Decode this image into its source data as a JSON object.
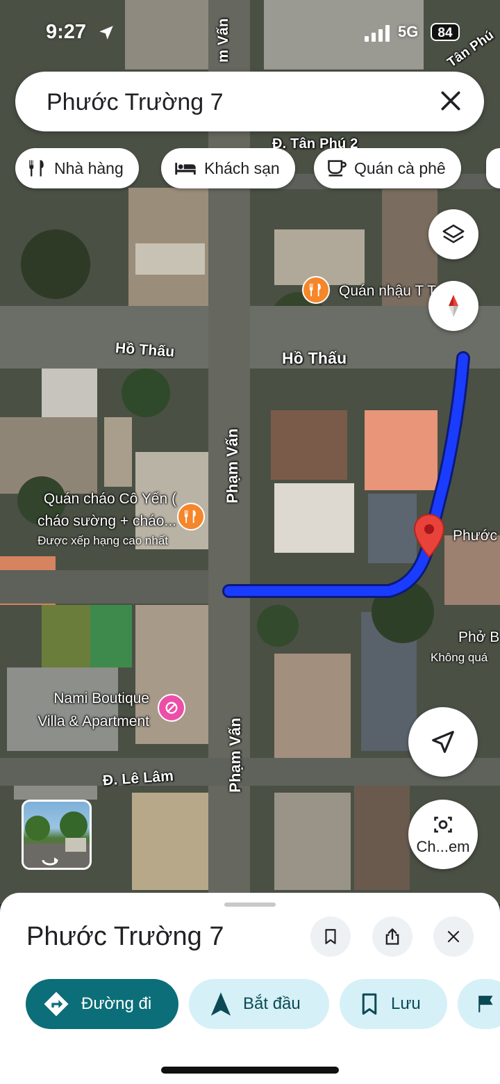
{
  "status_bar": {
    "time": "9:27",
    "network": "5G",
    "battery": "84"
  },
  "search": {
    "query": "Phước Trường 7"
  },
  "chips": [
    {
      "label": "Nhà hàng",
      "icon": "restaurant-icon"
    },
    {
      "label": "Khách sạn",
      "icon": "hotel-icon"
    },
    {
      "label": "Quán cà phê",
      "icon": "coffee-icon"
    }
  ],
  "map": {
    "street_labels": {
      "top_pham_van": "m Vấn",
      "top_tan_phu": "Tân Phú",
      "tan_phu_2": "Đ. Tân Phú 2",
      "ho_thau_left": "Hồ Thấu",
      "ho_thau_main": "Hồ Thấu",
      "pham_van_mid": "Phạm Vấn",
      "pham_van_low": "Phạm Vấn",
      "le_lam": "Đ. Lê Lâm"
    },
    "pois": {
      "quan_nhau": {
        "name": "Quán nhậu T     Trố",
        "icon": "restaurant-icon"
      },
      "quan_chao": {
        "name_line1": "Quán cháo Cô Yến (",
        "name_line2": "cháo sường + cháo...",
        "subtitle": "Được xếp hạng cao nhất",
        "icon": "restaurant-icon"
      },
      "nami": {
        "name_line1": "Nami Boutique",
        "name_line2": "Villa & Apartment",
        "icon": "hotel-icon"
      },
      "pho": {
        "name": "Phở B",
        "subtitle": "Không quá"
      },
      "destination": {
        "name": "Phước"
      }
    },
    "buttons": {
      "layers": "layers-icon",
      "compass": "compass-icon",
      "my_location": "navigation-arrow-icon",
      "lens_label": "Ch...em"
    }
  },
  "sheet": {
    "title": "Phước Trường 7",
    "actions": [
      {
        "label": "Đường đi",
        "icon": "directions-icon"
      },
      {
        "label": "Bắt đầu",
        "icon": "navigation-icon"
      },
      {
        "label": "Lưu",
        "icon": "bookmark-icon"
      }
    ]
  },
  "colors": {
    "route": "#1a3cff",
    "primary": "#0b6e78",
    "chip_secondary": "#d6f0f8",
    "pin": "#e8423a",
    "poi_food": "#f5862a",
    "poi_hotel": "#ec4fa7"
  }
}
